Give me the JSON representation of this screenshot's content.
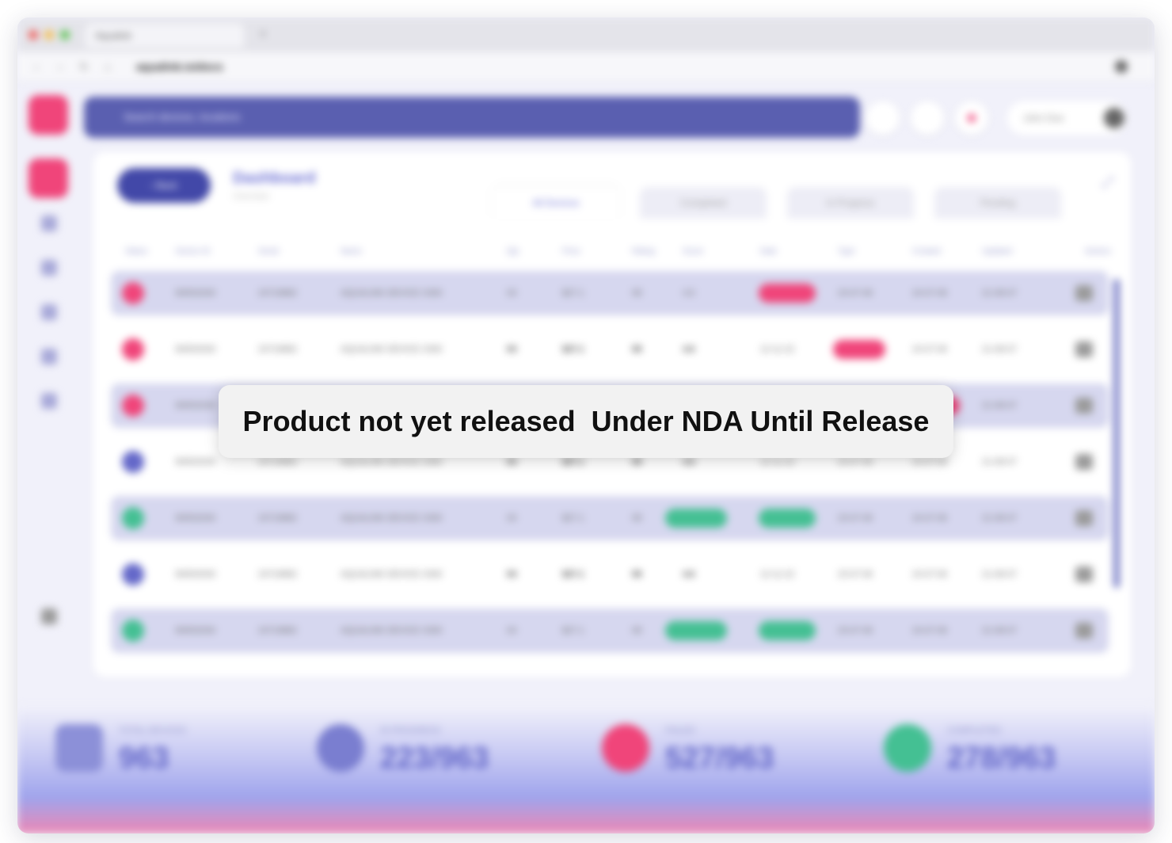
{
  "browser": {
    "tab_title": "Aqualink",
    "new_tab": "+",
    "url": "aqualink.io/docs",
    "nav": {
      "back": "‹",
      "forward": "›",
      "reload": "↻",
      "home": "⌂"
    },
    "dot_colors": [
      "#f0605a",
      "#f5be4f",
      "#5fc454"
    ]
  },
  "app": {
    "search_placeholder": "Search devices, locations",
    "user_name": "John Doe"
  },
  "page": {
    "back_label": "‹  Back",
    "title": "Dashboard",
    "subtitle": "Overview",
    "expand_icon": "⤢",
    "tabs": [
      "All Devices",
      "Completed",
      "In Progress",
      "Pending"
    ]
  },
  "table": {
    "headers": [
      "Status",
      "Device ID",
      "Serial",
      "Name",
      "Qty",
      "Price",
      "Rating",
      "Score",
      "Date",
      "Type",
      "Created",
      "Updated",
      "Actions"
    ],
    "rows": [
      {
        "status": "red",
        "band": true,
        "id": "B4502030",
        "serial": "24719882",
        "name": "AQUALINK DEVICE X300",
        "qty": "04",
        "price": "$27.1",
        "rating": "08",
        "score": "4.6",
        "date": "12-11-22",
        "type": "23-07-06",
        "created": "24-07-06",
        "updated": "21-08-07",
        "pill": {
          "col": "date",
          "color": "red"
        }
      },
      {
        "status": "red",
        "band": false,
        "id": "B4502030",
        "serial": "24719882",
        "name": "AQUALINK DEVICE X300",
        "qty": "04",
        "price": "$27.1",
        "rating": "08",
        "score": "4.6",
        "date": "12-11-22",
        "type": "23-07-06",
        "created": "24-07-06",
        "updated": "21-08-07",
        "pill": {
          "col": "type",
          "color": "red"
        }
      },
      {
        "status": "red",
        "band": true,
        "id": "B4502030",
        "serial": "24719882",
        "name": "AQUALINK DEVICE X300",
        "qty": "04",
        "price": "$27.1",
        "rating": "08",
        "score": "4.6",
        "date": "12-11-22",
        "type": "23-07-06",
        "created": "24-07-06",
        "updated": "21-08-07",
        "pill": {
          "col": "created",
          "color": "red"
        }
      },
      {
        "status": "purple",
        "band": false,
        "id": "B4502030",
        "serial": "24719882",
        "name": "AQUALINK DEVICE X300",
        "qty": "04",
        "price": "$27.1",
        "rating": "08",
        "score": "4.6",
        "date": "12-11-22",
        "type": "23-07-06",
        "created": "24-07-06",
        "updated": "21-08-07",
        "pill": null
      },
      {
        "status": "green",
        "band": true,
        "id": "B4502030",
        "serial": "24719882",
        "name": "AQUALINK DEVICE X300",
        "qty": "04",
        "price": "$27.1",
        "rating": "08",
        "score": "4.6",
        "date": "12-11-22",
        "type": "23-07-06",
        "created": "24-07-06",
        "updated": "21-08-07",
        "pill": {
          "col": "score,date",
          "color": "green"
        }
      },
      {
        "status": "purple",
        "band": false,
        "id": "B4502030",
        "serial": "24719882",
        "name": "AQUALINK DEVICE X300",
        "qty": "04",
        "price": "$27.1",
        "rating": "08",
        "score": "4.6",
        "date": "12-11-22",
        "type": "23-07-06",
        "created": "24-07-06",
        "updated": "21-08-07",
        "pill": null
      },
      {
        "status": "green",
        "band": true,
        "id": "B4502030",
        "serial": "24719882",
        "name": "AQUALINK DEVICE X300",
        "qty": "04",
        "price": "$27.1",
        "rating": "08",
        "score": "4.6",
        "date": "12-11-22",
        "type": "23-07-06",
        "created": "24-07-06",
        "updated": "21-08-07",
        "pill": {
          "col": "score,date",
          "color": "green"
        }
      }
    ]
  },
  "stats": [
    {
      "label": "TOTAL DEVICES",
      "value": "963",
      "icon": "database-icon",
      "color": "#8c90d8"
    },
    {
      "label": "IN PROGRESS",
      "value": "223/963",
      "icon": "rocket-icon",
      "color": "#7a7ed0"
    },
    {
      "label": "FAILED",
      "value": "527/963",
      "icon": "error-icon",
      "color": "#f0457a"
    },
    {
      "label": "COMPLETED",
      "value": "278/963",
      "icon": "check-icon",
      "color": "#44c093"
    }
  ],
  "notice": {
    "text": "Product not yet released  Under NDA Until Release"
  },
  "colors": {
    "accent": "#5a5fb0",
    "danger": "#f0457a",
    "success": "#44c093",
    "band": "#d6d7ef"
  }
}
